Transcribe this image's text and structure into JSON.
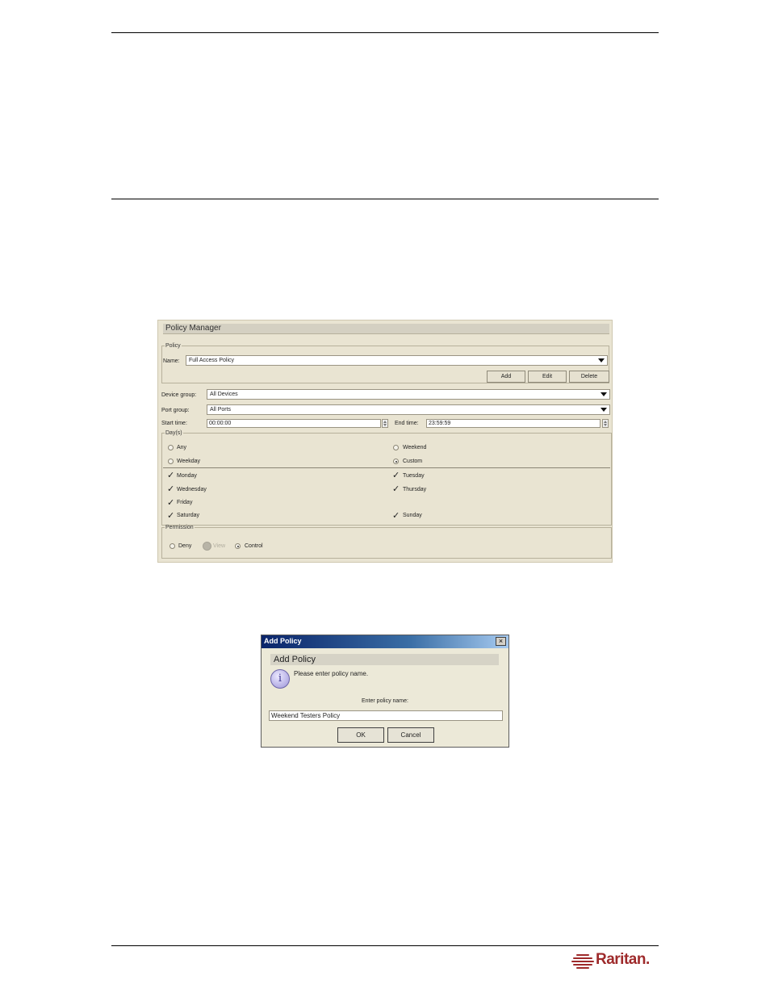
{
  "policy_manager": {
    "title": "Policy Manager",
    "policy_legend": "Policy",
    "name_label": "Name:",
    "name_value": "Full Access Policy",
    "buttons": {
      "add": "Add",
      "edit": "Edit",
      "delete": "Delete"
    },
    "device_group_label": "Device group:",
    "device_group_value": "All Devices",
    "port_group_label": "Port group:",
    "port_group_value": "All Ports",
    "start_time_label": "Start time:",
    "start_time_value": "00:00:00",
    "end_time_label": "End time:",
    "end_time_value": "23:59:59",
    "days_legend": "Day(s)",
    "day_modes": {
      "any": "Any",
      "weekend": "Weekend",
      "weekday": "Weekday",
      "custom": "Custom",
      "selected": "custom"
    },
    "days": {
      "monday": "Monday",
      "tuesday": "Tuesday",
      "wednesday": "Wednesday",
      "thursday": "Thursday",
      "friday": "Friday",
      "saturday": "Saturday",
      "sunday": "Sunday"
    },
    "permission_legend": "Permission",
    "permissions": {
      "deny": "Deny",
      "view": "View",
      "control": "Control",
      "selected": "control"
    }
  },
  "add_policy_dialog": {
    "window_title": "Add Policy",
    "close_glyph": "×",
    "heading": "Add Policy",
    "info_glyph": "i",
    "message": "Please enter policy name.",
    "prompt": "Enter policy name:",
    "name_value": "Weekend Testers Policy",
    "ok_label": "OK",
    "cancel_label": "Cancel"
  },
  "logo": {
    "text": "Raritan.",
    "color": "#9e2a2b"
  }
}
